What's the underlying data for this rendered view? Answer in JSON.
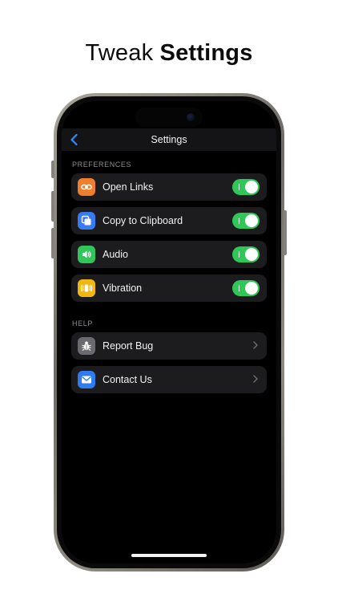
{
  "headline": {
    "regular": "Tweak",
    "bold": "Settings"
  },
  "nav": {
    "title": "Settings",
    "back_icon": "chevron-left-icon"
  },
  "sections": {
    "preferences": {
      "label": "PREFERENCES",
      "items": [
        {
          "label": "Open Links",
          "icon": "link-icon",
          "icon_color": "#f07f2d",
          "on": true
        },
        {
          "label": "Copy to Clipboard",
          "icon": "copy-icon",
          "icon_color": "#3a7bf1",
          "on": true
        },
        {
          "label": "Audio",
          "icon": "speaker-icon",
          "icon_color": "#31c55c",
          "on": true
        },
        {
          "label": "Vibration",
          "icon": "vibration-icon",
          "icon_color": "#f0b714",
          "on": true
        }
      ]
    },
    "help": {
      "label": "HELP",
      "items": [
        {
          "label": "Report Bug",
          "icon": "bug-icon",
          "icon_color": "#6a6a70"
        },
        {
          "label": "Contact Us",
          "icon": "mail-icon",
          "icon_color": "#2f7bf0"
        }
      ]
    }
  },
  "colors": {
    "toggle_on": "#30c759",
    "accent": "#2f8cff",
    "row_bg": "#1c1c1e"
  }
}
